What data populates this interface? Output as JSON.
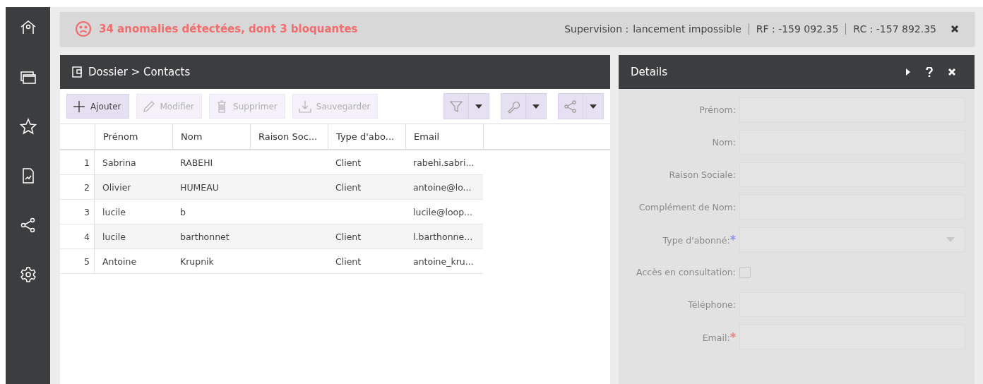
{
  "banner": {
    "alert": "34 anomalies détectées, dont 3 bloquantes",
    "supervision_label": "Supervision :",
    "supervision_value": "lancement impossible",
    "rf": "RF : -159 092.35",
    "rc": "RC : -157 892.35"
  },
  "main_panel": {
    "title": "Dossier > Contacts",
    "toolbar": [
      {
        "label": "Ajouter",
        "disabled": false
      },
      {
        "label": "Modifier",
        "disabled": true
      },
      {
        "label": "Supprimer",
        "disabled": true
      },
      {
        "label": "Sauvegarder",
        "disabled": true
      }
    ],
    "table": {
      "columns": [
        "Prénom",
        "Nom",
        "Raison Soc...",
        "Type d'abo...",
        "Email"
      ],
      "rows": [
        {
          "number": "1",
          "cells": [
            "Sabrina",
            "RABEHI",
            "",
            "Client",
            "rabehi.sabri..."
          ]
        },
        {
          "number": "2",
          "cells": [
            "Olivier",
            "HUMEAU",
            "",
            "Client",
            "antoine@lo..."
          ]
        },
        {
          "number": "3",
          "cells": [
            "lucile",
            "b",
            "",
            "",
            "lucile@loop..."
          ]
        },
        {
          "number": "4",
          "cells": [
            "lucile",
            "barthonnet",
            "",
            "Client",
            "l.barthonne..."
          ]
        },
        {
          "number": "5",
          "cells": [
            "Antoine",
            "Krupnik",
            "",
            "Client",
            "antoine_kru..."
          ]
        }
      ]
    }
  },
  "details_panel": {
    "title": "Details",
    "disabled": true,
    "fields": [
      {
        "kind": "input",
        "label": "Prénom:"
      },
      {
        "kind": "input",
        "label": "Nom:"
      },
      {
        "kind": "input",
        "label": "Raison Sociale:"
      },
      {
        "kind": "input",
        "label": "Complément de Nom:"
      },
      {
        "kind": "select",
        "label": "Type d'abonné:",
        "required_mark": "*",
        "color": "#8c8cf0"
      },
      {
        "kind": "checkbox",
        "label": "Accès en consultation:",
        "checked": false
      },
      {
        "kind": "input",
        "label": "Téléphone:"
      },
      {
        "kind": "input",
        "label": "Email:",
        "required_mark": "*",
        "color": "#f08080"
      }
    ]
  }
}
